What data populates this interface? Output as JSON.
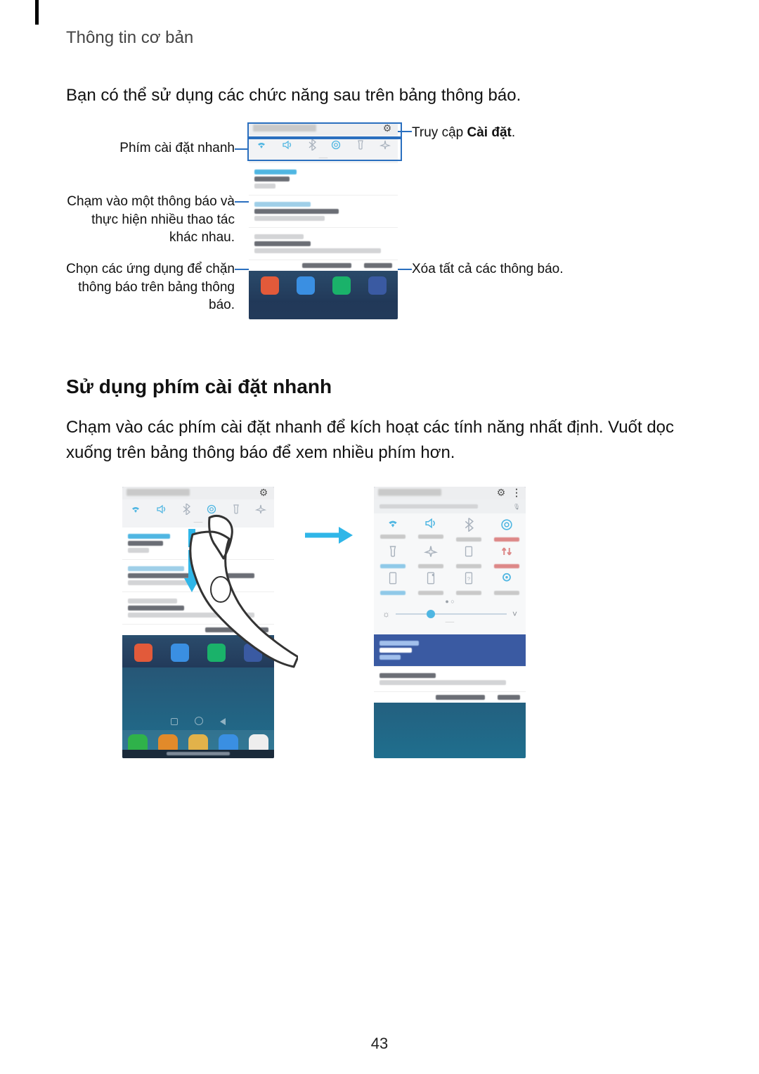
{
  "header": {
    "section_title": "Thông tin cơ bản"
  },
  "intro": "Bạn có thể sử dụng các chức năng sau trên bảng thông báo.",
  "callouts": {
    "quick_keys": "Phím cài đặt nhanh",
    "tap_notif": "Chạm vào một thông báo và thực hiện nhiều thao tác khác nhau.",
    "block_apps": "Chọn các ứng dụng để chặn thông báo trên bảng thông báo.",
    "access_settings_pre": "Truy cập ",
    "access_settings_bold": "Cài đặt",
    "access_settings_post": ".",
    "clear_all": "Xóa tất cả các thông báo."
  },
  "h2": "Sử dụng phím cài đặt nhanh",
  "body2": "Chạm vào các phím cài đặt nhanh để kích hoạt các tính năng nhất định. Vuốt dọc xuống trên bảng thông báo để xem nhiều phím hơn.",
  "page_number": "43",
  "icons": {
    "gear": "⚙",
    "wifi": "wifi-icon",
    "sound": "sound-icon",
    "bt": "bluetooth-icon",
    "rotate": "rotate-icon",
    "flash": "flashlight-icon",
    "plane": "airplane-icon",
    "more": "more-icon",
    "power": "power-saving-icon",
    "mobile": "mobile-data-icon",
    "bluelight": "blue-light-icon",
    "hotspot": "hotspot-icon",
    "private": "private-mode-icon",
    "location": "location-icon",
    "brightness": "brightness-icon",
    "chevron_down": "˅",
    "drag_handle": "⸺",
    "mic": "🎤"
  },
  "colors": {
    "accent": "#4fb6e2",
    "callout_line": "#2a6fbf"
  }
}
